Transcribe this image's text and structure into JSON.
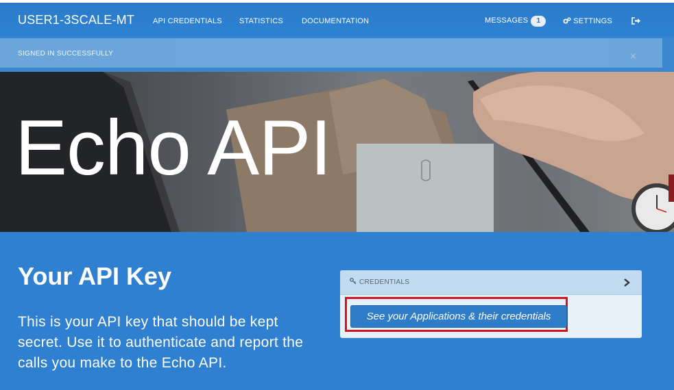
{
  "navbar": {
    "brand": "USER1-3SCALE-MT",
    "links": [
      "API CREDENTIALS",
      "STATISTICS",
      "DOCUMENTATION"
    ],
    "messages_label": "MESSAGES",
    "messages_count": "1",
    "settings_label": "SETTINGS"
  },
  "alert": {
    "text": "SIGNED IN SUCCESSFULLY",
    "close": "×"
  },
  "hero": {
    "title": "Echo API"
  },
  "main": {
    "title": "Your API Key",
    "description": "This is your API key that should be kept secret. Use it to authenticate and report the calls you make to the Echo API."
  },
  "credentials_panel": {
    "header": "CREDENTIALS",
    "button": "See your Applications & their credentials"
  },
  "colors": {
    "accent": "#2f80d1",
    "highlight": "#d4141c"
  }
}
